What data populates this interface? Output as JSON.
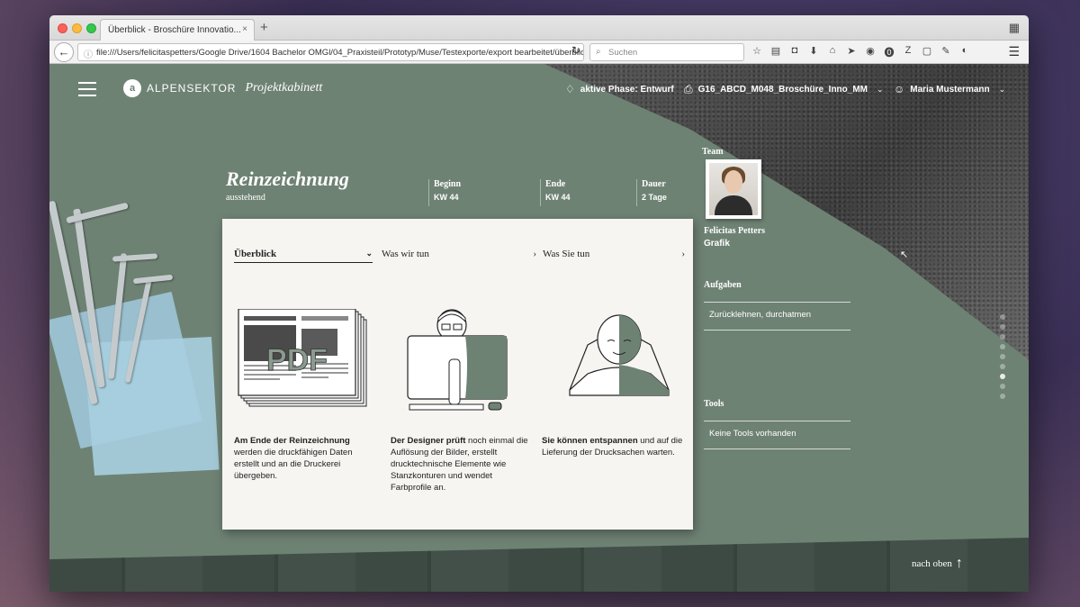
{
  "browser": {
    "tab_title": "Überblick - Broschüre Innovatio...",
    "tab_close": "×",
    "new_tab": "+",
    "url": "file:///Users/felicitaspetters/Google Drive/1604 Bachelor OMGl/04_Praxisteil/Prototyp/Muse/Testexporte/export bearbeitet/überblick",
    "search_placeholder": "Suchen"
  },
  "header": {
    "logo_text": "ALPENSEKTOR",
    "logo_sub": "Projektkabinett",
    "phase_label": "aktive Phase: Entwurf",
    "project_label": "G16_ABCD_M048_Broschüre_Inno_MM",
    "user_name": "Maria Mustermann"
  },
  "phase": {
    "title": "Reinzeichnung",
    "status": "ausstehend",
    "beginn_label": "Beginn",
    "beginn_value": "KW 44",
    "ende_label": "Ende",
    "ende_value": "KW 44",
    "dauer_label": "Dauer",
    "dauer_value": "2 Tage"
  },
  "card": {
    "tabs": [
      {
        "label": "Überblick"
      },
      {
        "label": "Was wir tun"
      },
      {
        "label": "Was Sie tun"
      }
    ],
    "pdf_label": "PDF",
    "columns": [
      {
        "bold": "Am Ende der Reinzeichnung",
        "text": " werden die druckfähigen Daten erstellt und an die Druckerei übergeben."
      },
      {
        "bold": "Der Designer prüft",
        "text": " noch einmal die Auflösung der Bilder, erstellt drucktechnische Elemente wie Stanzkonturen und wendet Farbprofile an."
      },
      {
        "bold": "Sie können entspannen",
        "text": " und auf die Lieferung der Drucksachen warten."
      }
    ]
  },
  "sidebar": {
    "team_label": "Team",
    "member_name": "Felicitas Petters",
    "member_role": "Grafik",
    "aufgaben_label": "Aufgaben",
    "aufgaben_item": "Zurücklehnen, durchatmen",
    "tools_label": "Tools",
    "tools_item": "Keine Tools vorhanden"
  },
  "footer": {
    "to_top": "nach oben"
  }
}
